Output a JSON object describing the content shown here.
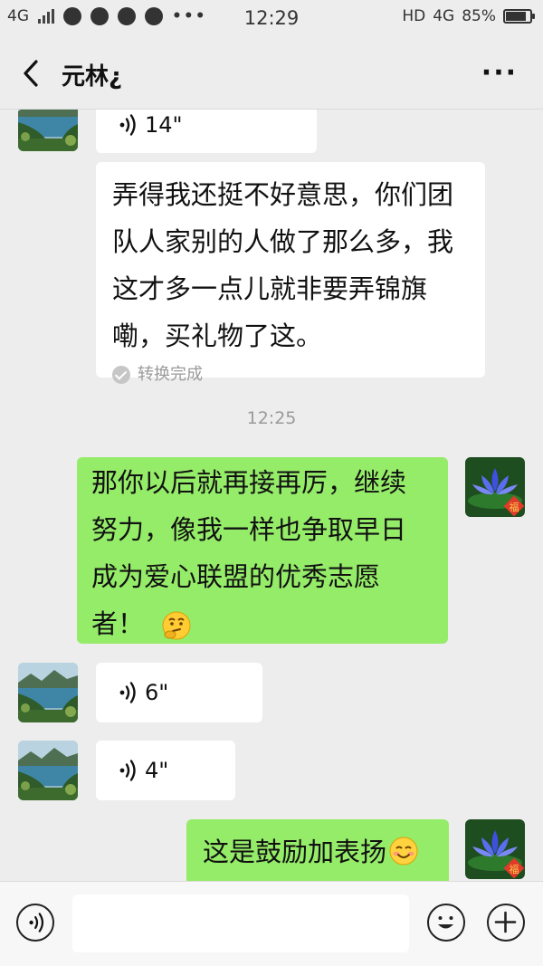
{
  "status_bar": {
    "network": "4G",
    "time": "12:29",
    "hd": "HD",
    "network_right": "4G",
    "battery_text": "85%",
    "battery_level": 0.85
  },
  "header": {
    "title": "元林¿",
    "back_icon": "chevron-left-icon",
    "more_icon": "more-dots-icon"
  },
  "messages": [
    {
      "type": "voice",
      "side": "left",
      "duration": "14\""
    },
    {
      "type": "text",
      "side": "left",
      "text": "弄得我还挺不好意思，你们团队人家别的人做了那么多，我这才多一点儿就非要弄锦旗嘞，买礼物了这。",
      "lines": [
        "弄得我还挺不好意思，你们团",
        "队人家别的人做了那么多，我",
        "这才多一点儿就非要弄锦旗",
        "嘞，买礼物了这。"
      ],
      "convert_status": "转换完成"
    },
    {
      "type": "timestamp",
      "text": "12:25"
    },
    {
      "type": "text",
      "side": "right",
      "lines": [
        "那你以后就再接再厉，继续",
        "努力，像我一样也争取早日",
        "成为爱心联盟的优秀志愿",
        "者！"
      ],
      "emoji": "thinking-face-emoji"
    },
    {
      "type": "voice",
      "side": "left",
      "duration": "6\""
    },
    {
      "type": "voice",
      "side": "left",
      "duration": "4\""
    },
    {
      "type": "text",
      "side": "right",
      "text": "这是鼓励加表扬",
      "emoji": "smiling-face-emoji"
    }
  ],
  "input_bar": {
    "voice_icon": "voice-mode-icon",
    "input_value": "",
    "emoji_icon": "emoji-icon",
    "plus_icon": "plus-icon"
  },
  "colors": {
    "background": "#ededed",
    "right_bubble": "#95ec69",
    "left_bubble": "#ffffff",
    "timestamp_text": "#9a9a9a"
  }
}
